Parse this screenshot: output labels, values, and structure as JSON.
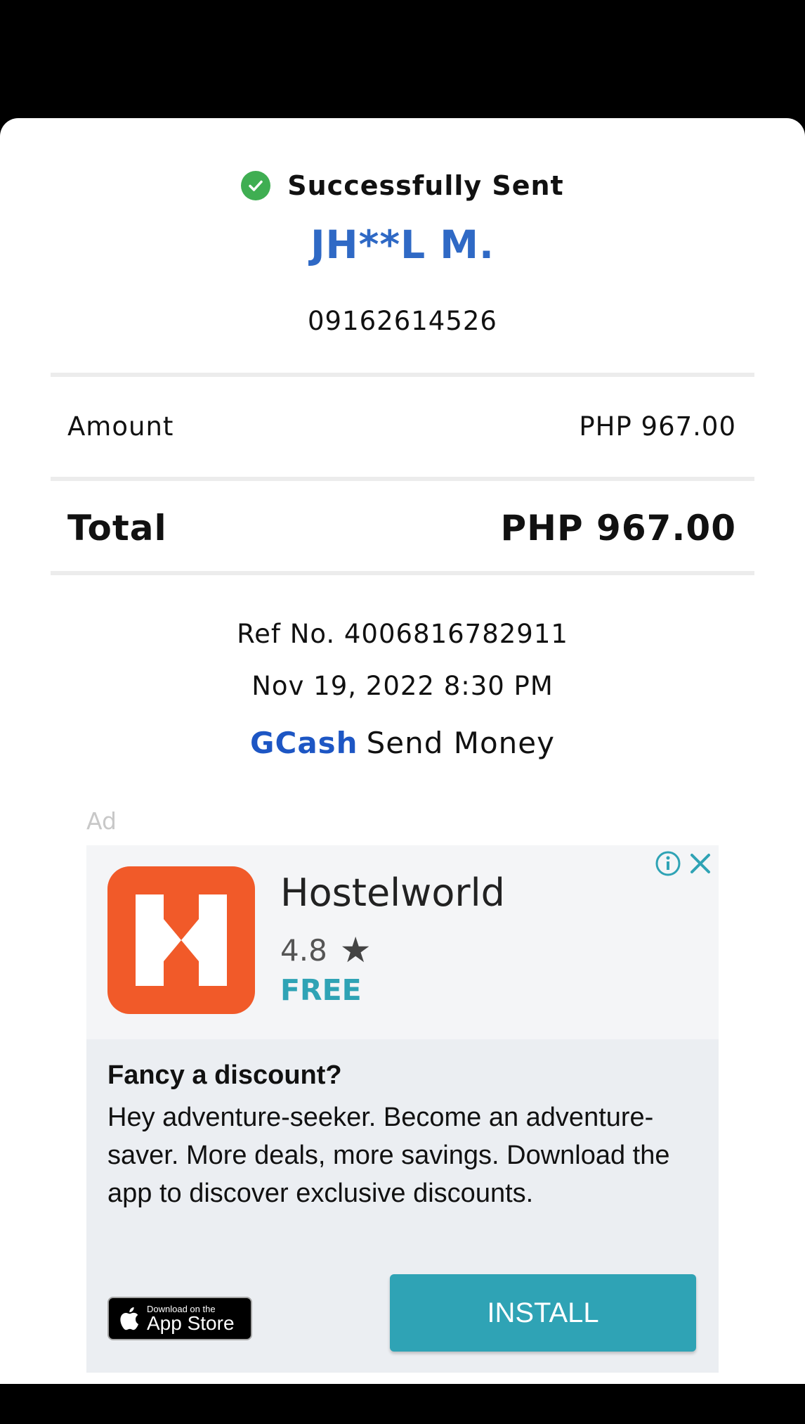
{
  "receipt": {
    "status": "Successfully Sent",
    "recipient_name": "JH**L M.",
    "recipient_number": "09162614526",
    "amount_label": "Amount",
    "amount_value": "PHP 967.00",
    "total_label": "Total",
    "total_value": "PHP 967.00",
    "ref_no": "Ref No. 4006816782911",
    "datetime": "Nov 19, 2022 8:30 PM",
    "brand": "GCash",
    "service": "Send Money"
  },
  "ad": {
    "label": "Ad",
    "app_name": "Hostelworld",
    "rating": "4.8",
    "price": "FREE",
    "headline": "Fancy a discount?",
    "body": "Hey adventure-seeker. Become an adventure-saver. More deals, more savings. Download the app to discover exclusive discounts.",
    "badge_small": "Download on the",
    "badge_big": "App Store",
    "install_label": "INSTALL"
  },
  "icons": {
    "status": "check-circle-icon",
    "star": "star-icon",
    "info": "info-icon",
    "close": "close-icon",
    "apple": "apple-icon"
  },
  "colors": {
    "success_green": "#3fae52",
    "recipient_blue": "#2f69c5",
    "brand_blue": "#1d56c4",
    "ad_accent_teal": "#2fa3b5",
    "app_icon_orange": "#f15a29"
  }
}
